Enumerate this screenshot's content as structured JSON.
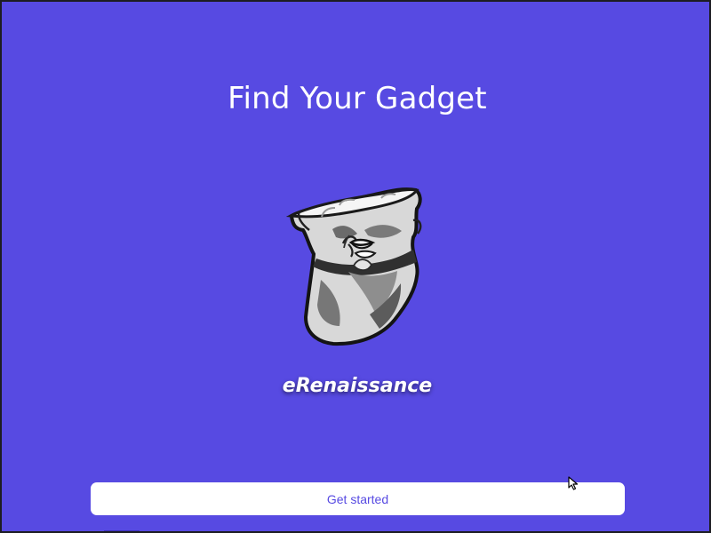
{
  "app": {
    "title": "Find Your Gadget",
    "brand_name": "eRenaissance",
    "logo_icon": "statue-head-icon"
  },
  "actions": {
    "get_started_label": "Get started"
  },
  "colors": {
    "background": "#574ae2",
    "title_text": "#ffffff",
    "button_background": "#ffffff",
    "button_text": "#574ae2"
  }
}
